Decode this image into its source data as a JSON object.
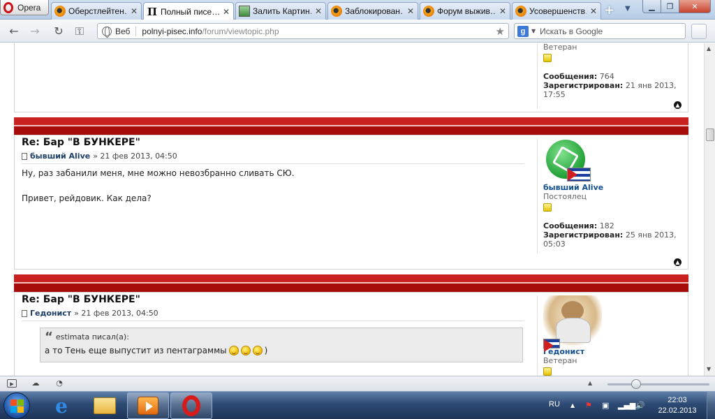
{
  "browser": {
    "menu_label": "Opera",
    "tabs": [
      {
        "title": "Оберстлейтен…",
        "icon": "forum-favicon",
        "active": false
      },
      {
        "title": "Полный писе…",
        "icon": "p-favicon",
        "active": true
      },
      {
        "title": "Залить Картин…",
        "icon": "image-favicon",
        "active": false
      },
      {
        "title": "Заблокирован…",
        "icon": "forum-favicon",
        "active": false
      },
      {
        "title": "Форум выжив…",
        "icon": "forum-favicon",
        "active": false
      },
      {
        "title": "Усовершенств…",
        "icon": "forum-favicon",
        "active": false
      }
    ],
    "address": {
      "scheme_label": "Веб",
      "host": "polnyi-pisec.info",
      "path": "/forum/viewtopic.php"
    },
    "search": {
      "placeholder": "Искать в Google",
      "engine": "google-icon"
    }
  },
  "forum": {
    "prev_post_profile": {
      "rank": "Ветеран",
      "posts_label": "Сообщения:",
      "posts": "764",
      "registered_label": "Зарегистрирован:",
      "registered_line1": "21 янв 2013,",
      "registered_line2": "17:55"
    },
    "posts": [
      {
        "title": "Re: Бар \"В БУНКЕРЕ\"",
        "author": "бывший Alive",
        "date": "» 21 фев 2013, 04:50",
        "lines": [
          "Ну, раз забанили меня, мне можно невозбранно сливать СЮ.",
          "Привет, рейдовик. Как дела?"
        ],
        "profile": {
          "name": "бывший Alive",
          "rank": "Постоялец",
          "posts_label": "Сообщения:",
          "posts": "182",
          "registered_label": "Зарегистрирован:",
          "registered_line1": "25 янв 2013,",
          "registered_line2": "05:03"
        }
      },
      {
        "title": "Re: Бар \"В БУНКЕРЕ\"",
        "author": "Гедонист",
        "date": "» 21 фев 2013, 04:50",
        "quote": {
          "author_line": "estimata писал(а):",
          "text": "а то Тень еще выпустит из пентаграммы",
          "tail": ")"
        },
        "profile": {
          "name": "Гедонист",
          "rank": "Ветеран"
        }
      }
    ]
  },
  "taskbar": {
    "language": "RU",
    "time": "22:03",
    "date": "22.02.2013"
  },
  "colors": {
    "post_bar_red": "#b8100e",
    "author_blue": "#12508f",
    "opera_red": "#cc1016"
  }
}
